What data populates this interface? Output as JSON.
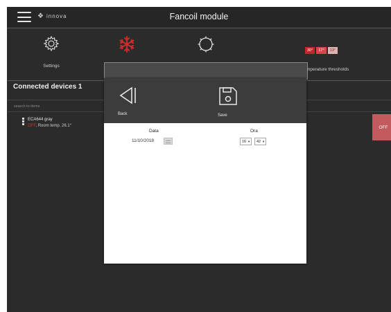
{
  "header": {
    "logo_text": "innova",
    "title": "Fancoil module"
  },
  "toolbar": {
    "settings_label": "Settings",
    "thresholds_label": "mperature thresholds",
    "threshold_values": [
      "30°",
      "17°",
      "13°"
    ]
  },
  "devices": {
    "title": "Connected devices 1",
    "search_placeholder": "search to items",
    "items": [
      {
        "name": "ECA644 gray",
        "state": "OFF",
        "temp_text": "Room temp. 26.1°",
        "action_label": "OFF"
      }
    ]
  },
  "modal": {
    "back_label": "Back",
    "save_label": "Save",
    "date_label": "Data",
    "date_value": "11/10/2018",
    "time_label": "Ora",
    "hour_value": "16",
    "minute_value": "42"
  },
  "colors": {
    "background": "#2b2b2b",
    "header": "#262626",
    "snowflake": "#d02a2a",
    "off_button": "#c35a5e",
    "modal_actions": "#3c3c3c",
    "threshold_1": "#c0282c",
    "threshold_2": "#d8454a",
    "threshold_3": "#e0b3b3"
  }
}
